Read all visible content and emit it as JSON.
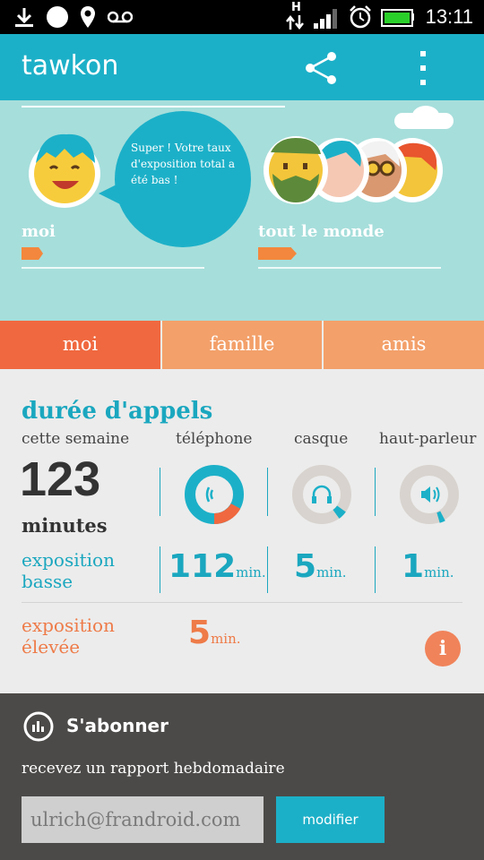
{
  "status": {
    "time": "13:11",
    "network": "H"
  },
  "app": {
    "title": "tawkon"
  },
  "hero": {
    "speech": "Super ! Votre taux d'exposition total a été bas !",
    "left_label": "moi",
    "right_label": "tout le monde",
    "left_level": 0.12,
    "right_level": 0.21
  },
  "tabs": [
    {
      "label": "moi",
      "active": true
    },
    {
      "label": "famille",
      "active": false
    },
    {
      "label": "amis",
      "active": false
    }
  ],
  "stats": {
    "heading": "durée d'appels",
    "period": "cette semaine",
    "total_value": "123",
    "total_unit": "minutes",
    "col_phone": "téléphone",
    "col_headset": "casque",
    "col_speaker": "haut-parleur",
    "low_label_1": "exposition",
    "low_label_2": "basse",
    "low_phone": "112",
    "low_headset": "5",
    "low_speaker": "1",
    "unit": "min.",
    "high_label_1": "exposition",
    "high_label_2": "élevée",
    "high_value": "5",
    "info": "i"
  },
  "subscribe": {
    "title": "S'abonner",
    "subtitle": "recevez un rapport hebdomadaire",
    "email": "ulrich@frandroid.com",
    "button": "modifier"
  },
  "colors": {
    "teal": "#1cb0c8",
    "orange": "#f07f4b",
    "hero": "#a6dedb",
    "dark": "#4c4a48"
  }
}
